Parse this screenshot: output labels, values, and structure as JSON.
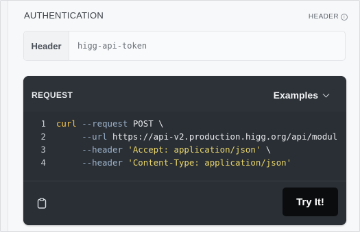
{
  "authentication": {
    "title": "AUTHENTICATION",
    "tag": "HEADER",
    "header_label": "Header",
    "header_value": "higg-api-token"
  },
  "request": {
    "title": "REQUEST",
    "examples_label": "Examples",
    "code_lines": [
      {
        "num": "1",
        "parts": [
          {
            "t": "curl",
            "c": "kw"
          },
          {
            "t": " --request ",
            "c": "flag"
          },
          {
            "t": "POST \\",
            "c": "plain"
          }
        ]
      },
      {
        "num": "2",
        "parts": [
          {
            "t": "     --url ",
            "c": "flag"
          },
          {
            "t": "https://api-v2.production.higg.org/api/modul",
            "c": "plain"
          }
        ]
      },
      {
        "num": "3",
        "parts": [
          {
            "t": "     --header ",
            "c": "flag"
          },
          {
            "t": "'Accept: application/json'",
            "c": "str"
          },
          {
            "t": " \\",
            "c": "plain"
          }
        ]
      },
      {
        "num": "4",
        "parts": [
          {
            "t": "     --header ",
            "c": "flag"
          },
          {
            "t": "'Content-Type: application/json'",
            "c": "str"
          }
        ]
      }
    ],
    "try_label": "Try It!"
  },
  "icons": {
    "info": "info-icon",
    "chevron": "chevron-down-icon",
    "copy": "clipboard-icon"
  },
  "colors": {
    "panel_bg": "#2a2f35",
    "keyword": "#f6c64a",
    "string": "#e8d56b",
    "button_bg": "#0b0c0e"
  }
}
